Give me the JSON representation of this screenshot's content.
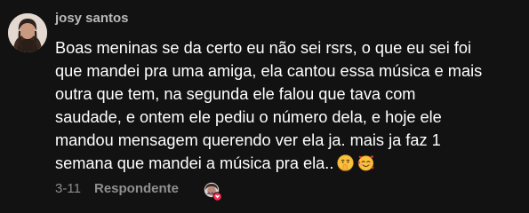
{
  "comment": {
    "username": "josy santos",
    "text_lines": [
      "Boas meninas se da certo eu não sei rsrs, o que eu sei foi",
      "que mandei pra uma amiga, ela cantou essa música e mais",
      "outra que tem, na segunda ele falou que tava com",
      "saudade, e ontem ele pediu o número dela, e hoje ele",
      "mandou mensagem querendo ver ela ja. mais ja faz 1",
      "semana que mandei a música pra ela.."
    ],
    "emojis": [
      "shushing-face-emoji",
      "smiling-face-with-hearts-emoji"
    ],
    "date": "3-11",
    "reply_label": "Respondente",
    "creator_liked_icon": "creator-heart-avatar-icon"
  },
  "colors": {
    "background": "#121212",
    "text": "#ffffff",
    "username": "#b9b9b9",
    "meta": "#8d8d8d",
    "heart": "#fe2c55"
  }
}
